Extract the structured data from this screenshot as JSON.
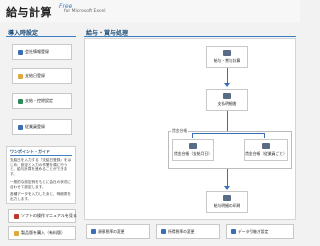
{
  "header": {
    "title": "給与計算",
    "edition": "Free",
    "subtitle": "for Microsoft Excel"
  },
  "left": {
    "section_title": "導入時設定",
    "buttons": [
      {
        "label": "会社情報登録",
        "icon": "building-icon"
      },
      {
        "label": "支給日登録",
        "icon": "calendar-icon"
      },
      {
        "label": "支給・控除設定",
        "icon": "settings-icon"
      },
      {
        "label": "従業員登録",
        "icon": "people-icon"
      }
    ]
  },
  "guide": {
    "title": "ワンポイント・ガイド",
    "paragraph1": "支給日を入力する「支給日登録」をはじめ、設定と入力の作業を順に行うと、給与計算を進めることができます。",
    "paragraph2": "一般的な設定例をもとに会社の状況に合わせて設定します。",
    "paragraph3": "各種データを入力したあと、明細書を出力します。"
  },
  "guide_buttons": [
    {
      "label": "ソフトの操作マニュアルを見る",
      "icon": "manual-icon"
    },
    {
      "label": "製品版を購入（有料版）",
      "icon": "cart-icon"
    }
  ],
  "main": {
    "section_title": "給与・賞与処理",
    "nodes": {
      "calc": "給与・賞与計算",
      "detail": "支払明細書",
      "ledger_pay": "賃金台帳（支給月日）",
      "ledger_employee": "賃金台帳（従業員ごと）",
      "print": "給与明細の印刷"
    },
    "group_label": "賃金台帳"
  },
  "bottom_buttons": [
    {
      "label": "源泉税率の変更",
      "icon": "edit-icon"
    },
    {
      "label": "所得税率の変更",
      "icon": "edit-icon"
    },
    {
      "label": "データ引継ぎ設定",
      "icon": "transfer-icon"
    }
  ],
  "colors": {
    "accent": "#3a7fc1",
    "header_text": "#1f4e79",
    "background": "#f2f2f2"
  }
}
